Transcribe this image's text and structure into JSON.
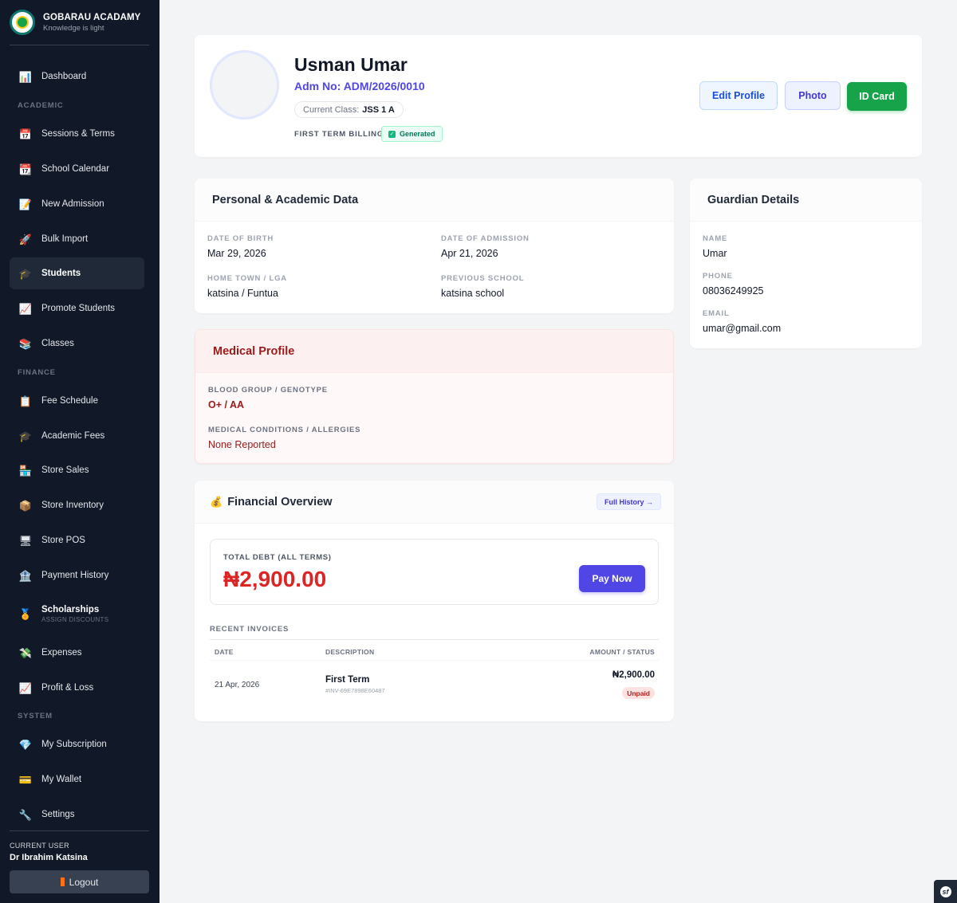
{
  "brand": {
    "name": "GOBARAU ACADAMY",
    "tagline": "Knowledge is light"
  },
  "sidebar": {
    "items": [
      {
        "label": "Dashboard",
        "icon": "chart-icon"
      },
      {
        "label": "Sessions & Terms",
        "icon": "calendar-icon"
      },
      {
        "label": "School Calendar",
        "icon": "calendar-icon"
      },
      {
        "label": "New Admission",
        "icon": "document-icon"
      },
      {
        "label": "Bulk Import",
        "icon": "rocket-icon"
      },
      {
        "label": "Students",
        "icon": "graduation-cap-icon",
        "active": true
      },
      {
        "label": "Promote Students",
        "icon": "trend-chart-icon"
      },
      {
        "label": "Classes",
        "icon": "books-icon"
      },
      {
        "label": "Fee Schedule",
        "icon": "clipboard-icon"
      },
      {
        "label": "Academic Fees",
        "icon": "graduation-cap-icon"
      },
      {
        "label": "Store Sales",
        "icon": "store-icon"
      },
      {
        "label": "Store Inventory",
        "icon": "package-icon"
      },
      {
        "label": "Store POS",
        "icon": "register-icon"
      },
      {
        "label": "Payment History",
        "icon": "bank-icon"
      },
      {
        "label": "Scholarships",
        "sublabel": "ASSIGN DISCOUNTS",
        "icon": "medal-icon"
      },
      {
        "label": "Expenses",
        "icon": "money-wings-icon"
      },
      {
        "label": "Profit & Loss",
        "icon": "trend-chart-icon"
      },
      {
        "label": "My Subscription",
        "icon": "diamond-icon"
      },
      {
        "label": "My Wallet",
        "icon": "credit-card-icon"
      },
      {
        "label": "Settings",
        "icon": "wrench-icon"
      }
    ],
    "sections": {
      "academic": "ACADEMIC",
      "finance": "FINANCE",
      "system": "SYSTEM"
    },
    "current_user_label": "CURRENT USER",
    "current_user": "Dr Ibrahim Katsina",
    "logout": "Logout"
  },
  "profile": {
    "name": "Usman Umar",
    "adm_no": "Adm No: ADM/2026/0010",
    "class_label": "Current Class:",
    "class_value": "JSS 1 A",
    "billing_label": "FIRST TERM BILLING:",
    "billing_status": "Generated",
    "buttons": {
      "edit": "Edit Profile",
      "photo": "Photo",
      "id_card": "ID Card"
    }
  },
  "personal": {
    "title": "Personal & Academic Data",
    "dob_label": "DATE OF BIRTH",
    "dob": "Mar 29, 2026",
    "doa_label": "DATE OF ADMISSION",
    "doa": "Apr 21, 2026",
    "town_label": "HOME TOWN / LGA",
    "town": "katsina / Funtua",
    "prev_label": "PREVIOUS SCHOOL",
    "prev": "katsina school"
  },
  "guardian": {
    "title": "Guardian Details",
    "name_label": "NAME",
    "name": "Umar",
    "phone_label": "PHONE",
    "phone": "08036249925",
    "email_label": "EMAIL",
    "email": "umar@gmail.com"
  },
  "medical": {
    "title": "Medical Profile",
    "blood_label": "BLOOD GROUP / GENOTYPE",
    "blood": "O+ / AA",
    "cond_label": "MEDICAL CONDITIONS / ALLERGIES",
    "cond": "None Reported"
  },
  "financial": {
    "title": "Financial Overview",
    "full_history": "Full History →",
    "debt_label": "TOTAL DEBT (ALL TERMS)",
    "debt_amount": "₦2,900.00",
    "pay_now": "Pay Now",
    "recent_label": "RECENT INVOICES",
    "columns": {
      "date": "DATE",
      "desc": "DESCRIPTION",
      "amount": "AMOUNT / STATUS"
    },
    "invoices": [
      {
        "date": "21 Apr, 2026",
        "desc": "First Term",
        "invoice_no": "#INV-69E7898E60487",
        "amount": "₦2,900.00",
        "status": "Unpaid"
      }
    ]
  },
  "colors": {
    "sidebar_bg": "#111827",
    "accent": "#4f46e5",
    "success": "#16a34a",
    "danger": "#dc2626"
  }
}
